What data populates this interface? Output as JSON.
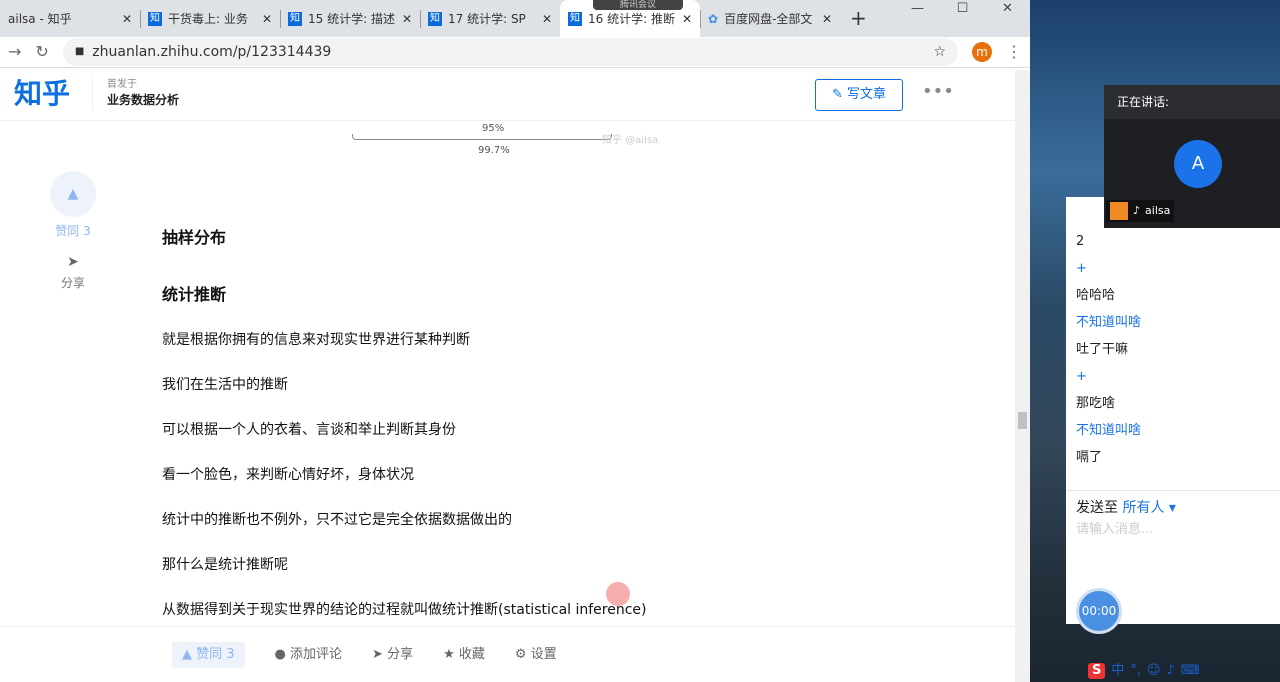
{
  "browser": {
    "tabs": [
      {
        "title": "ailsa - 知乎",
        "icon": "zhihu"
      },
      {
        "title": "干货毒上: 业务",
        "icon": "zhihu"
      },
      {
        "title": "15 统计学: 描述",
        "icon": "zhihu"
      },
      {
        "title": "17 统计学: SP",
        "icon": "zhihu"
      },
      {
        "title": "16 统计学: 推断",
        "icon": "zhihu",
        "active": true
      },
      {
        "title": "百度网盘-全部文",
        "icon": "baidu"
      }
    ],
    "fav_label": "知",
    "meeting_pill": "腾讯会议",
    "url": "zhuanlan.zhihu.com/p/123314439",
    "profile": "m"
  },
  "header": {
    "logo": "知乎",
    "column_prefix": "首发于",
    "column_name": "业务数据分析",
    "write_label": "写文章"
  },
  "figure": {
    "label_95": "95%",
    "label_997": "99.7%",
    "watermark": "知乎 @ailsa"
  },
  "side": {
    "vote_label": "赞同 3",
    "share_label": "分享"
  },
  "article": {
    "headings": [
      "抽样分布",
      "统计推断"
    ],
    "paragraphs": [
      "就是根据你拥有的信息来对现实世界进行某种判断",
      "我们在生活中的推断",
      "可以根据一个人的衣着、言谈和举止判断其身份",
      "看一个脸色，来判断心情好坏，身体状况",
      "统计中的推断也不例外，只不过它是完全依据数据做出的",
      "那什么是统计推断呢",
      "从数据得到关于现实世界的结论的过程就叫做统计推断(statistical inference)"
    ]
  },
  "bottom": {
    "vote": "▲ 赞同 3",
    "comment": "添加评论",
    "share": "分享",
    "collect": "收藏",
    "settings": "设置"
  },
  "meeting": {
    "speaking": "正在讲话:",
    "avatar": "A",
    "name": "ailsa"
  },
  "chat": {
    "messages": [
      {
        "text": "2",
        "sender": false
      },
      {
        "text": "+",
        "sender": true
      },
      {
        "text": "哈哈哈",
        "sender": false
      },
      {
        "text": "不知道叫啥",
        "sender": true
      },
      {
        "text": "吐了干嘛",
        "sender": false
      },
      {
        "text": "+",
        "sender": true
      },
      {
        "text": "那吃啥",
        "sender": false
      },
      {
        "text": "不知道叫啥",
        "sender": true
      },
      {
        "text": "嗝了",
        "sender": false
      }
    ],
    "send_to": "发送至",
    "recipient": "所有人 ▾",
    "placeholder": "请输入消息...",
    "timer": "00:00"
  },
  "ime": {
    "logo": "S",
    "mode": "中",
    "punct": "°,"
  }
}
